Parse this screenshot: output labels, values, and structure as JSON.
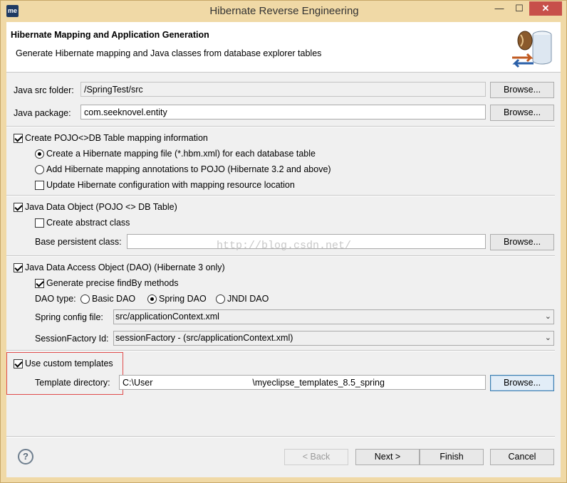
{
  "window": {
    "title": "Hibernate Reverse Engineering",
    "app_icon": "me",
    "controls": {
      "minimize": "—",
      "maximize": "☐",
      "close": "✕"
    }
  },
  "header": {
    "title": "Hibernate Mapping and Application Generation",
    "description": "Generate Hibernate mapping and Java classes from database explorer tables",
    "icon": "database-beans-icon"
  },
  "src": {
    "label": "Java src folder:",
    "value": "/SpringTest/src",
    "browse": "Browse..."
  },
  "package": {
    "label": "Java package:",
    "value": "com.seeknovel.entity",
    "browse": "Browse..."
  },
  "pojo_mapping": {
    "label": "Create POJO<>DB Table mapping information",
    "checked": true,
    "opt_hbm": "Create a Hibernate mapping file (*.hbm.xml) for each database table",
    "opt_annotations": "Add Hibernate mapping annotations to POJO (Hibernate 3.2 and above)",
    "opt_update_cfg": "Update Hibernate configuration with mapping resource location"
  },
  "java_data_object": {
    "label": "Java Data Object (POJO <> DB Table)",
    "abstract": "Create abstract class",
    "base_label": "Base persistent class:",
    "base_value": "",
    "browse": "Browse..."
  },
  "dao": {
    "label": "Java Data Access Object (DAO) (Hibernate 3 only)",
    "findby": "Generate precise findBy methods",
    "type_label": "DAO type:",
    "types": [
      "Basic DAO",
      "Spring DAO",
      "JNDI DAO"
    ],
    "selected_type": "Spring DAO",
    "spring_label": "Spring config file:",
    "spring_value": "src/applicationContext.xml",
    "sf_label": "SessionFactory Id:",
    "sf_value": "sessionFactory - (src/applicationContext.xml)"
  },
  "templates": {
    "label": "Use custom templates",
    "dir_label": "Template directory:",
    "dir_prefix": "C:\\User",
    "dir_suffix": "\\myeclipse_templates_8.5_spring",
    "browse": "Browse..."
  },
  "watermark": "http://blog.csdn.net/",
  "footer": {
    "help": "?",
    "back": "< Back",
    "next": "Next >",
    "finish": "Finish",
    "cancel": "Cancel"
  }
}
